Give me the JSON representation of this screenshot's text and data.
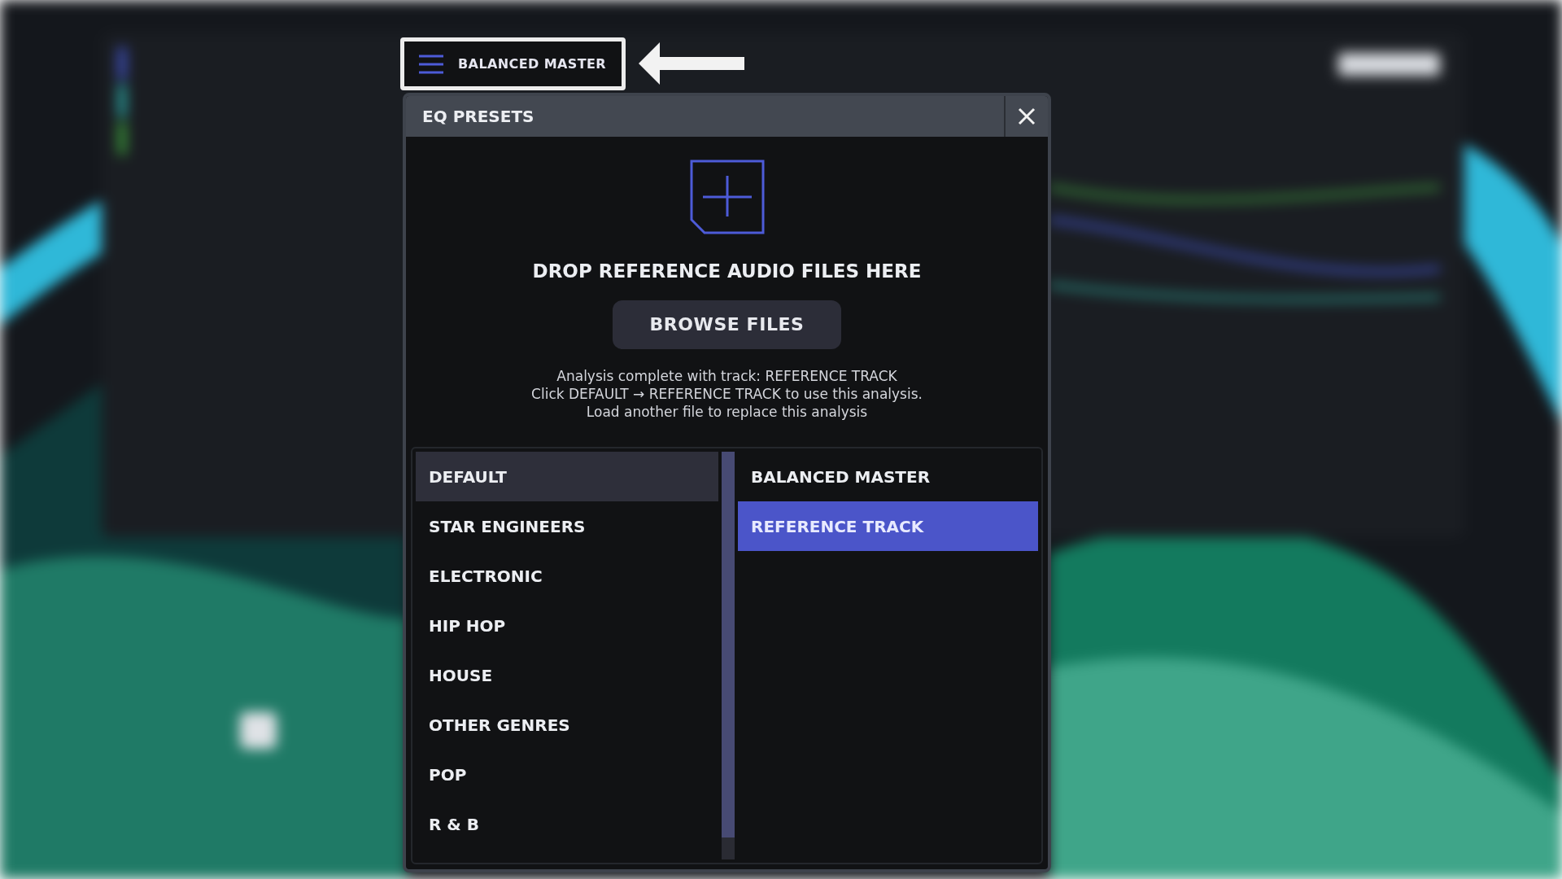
{
  "preset_button": {
    "label": "BALANCED MASTER"
  },
  "dialog": {
    "title": "EQ PRESETS",
    "drop_zone": {
      "heading": "DROP REFERENCE AUDIO FILES HERE",
      "button": "BROWSE FILES",
      "status_lines": [
        "Analysis complete with track: REFERENCE TRACK",
        "Click DEFAULT → REFERENCE TRACK to use this analysis.",
        "Load another file to replace this analysis"
      ]
    },
    "categories": [
      {
        "label": "DEFAULT",
        "selected": true
      },
      {
        "label": "STAR ENGINEERS",
        "selected": false
      },
      {
        "label": "ELECTRONIC",
        "selected": false
      },
      {
        "label": "HIP HOP",
        "selected": false
      },
      {
        "label": "HOUSE",
        "selected": false
      },
      {
        "label": "OTHER GENRES",
        "selected": false
      },
      {
        "label": "POP",
        "selected": false
      },
      {
        "label": "R & B",
        "selected": false
      }
    ],
    "presets": [
      {
        "label": "BALANCED MASTER",
        "selected": false
      },
      {
        "label": "REFERENCE TRACK",
        "selected": true
      }
    ]
  }
}
